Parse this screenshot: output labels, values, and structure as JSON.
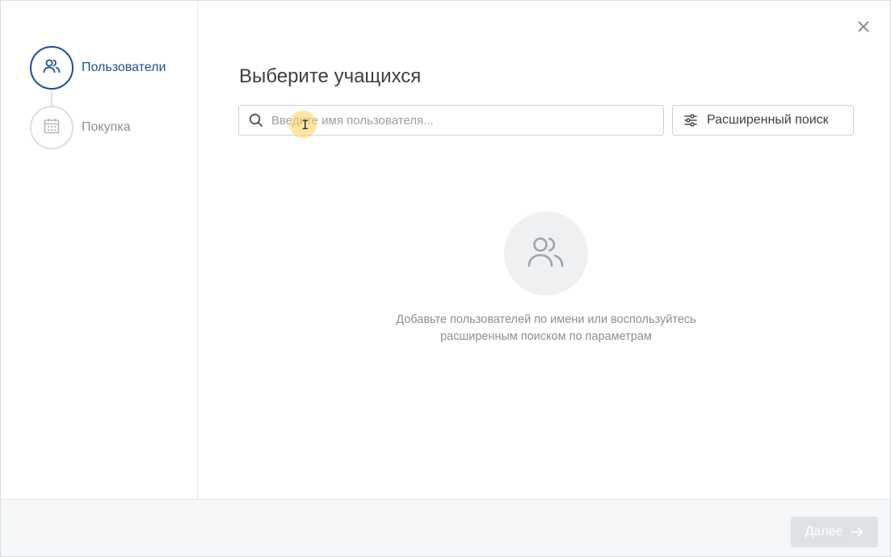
{
  "steps": [
    {
      "label": "Пользователи",
      "state": "active",
      "icon": "users-icon"
    },
    {
      "label": "Покупка",
      "state": "inactive",
      "icon": "calendar-icon"
    }
  ],
  "main": {
    "title": "Выберите учащихся",
    "search": {
      "placeholder": "Введите имя пользователя...",
      "value": ""
    },
    "advanced_search_label": "Расширенный поиск",
    "empty_state": {
      "icon": "users-icon",
      "line1": "Добавьте пользователей по имени или воспользуйтесь",
      "line2": "расширенным поиском по параметрам"
    }
  },
  "footer": {
    "next_label": "Далее"
  },
  "colors": {
    "accent": "#1d4f91",
    "muted": "#8a8f95",
    "border": "#cfd3d7",
    "disabled_button": "#dfe2e5"
  }
}
